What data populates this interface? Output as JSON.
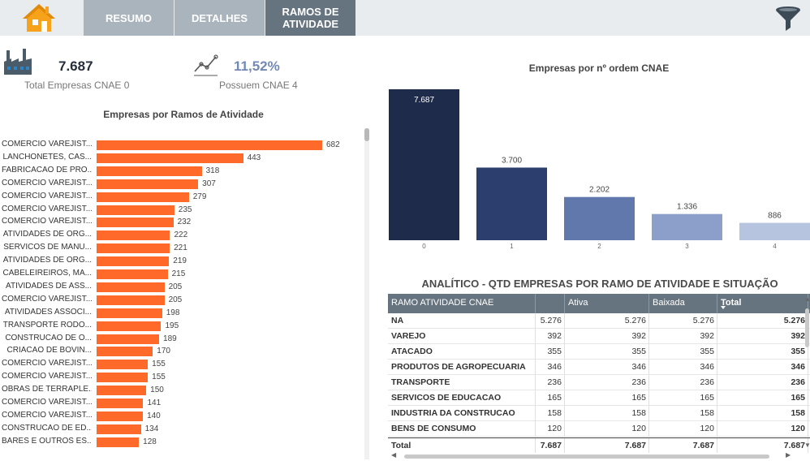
{
  "nav": {
    "tabs": [
      {
        "label": "RESUMO"
      },
      {
        "label": "DETALHES"
      },
      {
        "label": "RAMOS DE\nATIVIDADE"
      }
    ],
    "active_tab": 2
  },
  "kpis": [
    {
      "value": "7.687",
      "label": "Total Empresas CNAE 0"
    },
    {
      "value": "11,52%",
      "label": "Possuem CNAE 4"
    }
  ],
  "colors": {
    "orange": "#ff6a2b",
    "nav_active": "#66747f",
    "nav_inactive": "#a9b4bd",
    "home": "#f7a21b"
  },
  "icons": {
    "home": "home-icon",
    "filter": "filter-icon",
    "factory": "factory-icon",
    "trend": "trend-line-icon"
  },
  "chart_data": [
    {
      "type": "bar",
      "orientation": "horizontal",
      "title": "Empresas por Ramos de Atividade",
      "categories": [
        "COMERCIO VAREJIST...",
        "LANCHONETES, CAS...",
        "FABRICACAO DE PRO...",
        "COMERCIO VAREJIST...",
        "COMERCIO VAREJIST...",
        "COMERCIO VAREJIST...",
        "COMERCIO VAREJIST...",
        "ATIVIDADES DE ORG...",
        "SERVICOS DE MANU...",
        "ATIVIDADES DE ORG...",
        "CABELEIREIROS, MA...",
        "ATIVIDADES DE ASS...",
        "COMERCIO VAREJIST...",
        "ATIVIDADES ASSOCI...",
        "TRANSPORTE RODO...",
        "CONSTRUCAO DE O...",
        "CRIACAO DE BOVIN...",
        "COMERCIO VAREJIST...",
        "COMERCIO VAREJIST...",
        "OBRAS DE TERRAPLE...",
        "COMERCIO VAREJIST...",
        "COMERCIO VAREJIST...",
        "CONSTRUCAO DE ED...",
        "BARES E OUTROS ES..."
      ],
      "values": [
        682,
        443,
        318,
        307,
        279,
        235,
        232,
        222,
        221,
        219,
        215,
        205,
        205,
        198,
        195,
        189,
        170,
        155,
        155,
        150,
        141,
        140,
        134,
        128
      ],
      "value_labels": [
        "682",
        "443",
        "318",
        "307",
        "279",
        "235",
        "232",
        "222",
        "221",
        "219",
        "215",
        "205",
        "205",
        "198",
        "195",
        "189",
        "170",
        "155",
        "155",
        "150",
        "141",
        "140",
        "134",
        "128"
      ],
      "color": "#ff6a2b"
    },
    {
      "type": "bar",
      "title": "Empresas por nº ordem CNAE",
      "categories": [
        "0",
        "1",
        "2",
        "3",
        "4"
      ],
      "values": [
        7687,
        3700,
        2202,
        1336,
        886
      ],
      "value_labels": [
        "7.687",
        "3.700",
        "2.202",
        "1.336",
        "886"
      ],
      "colors": [
        "#1f2b4b",
        "#2c3e6e",
        "#6178ad",
        "#8b9fca",
        "#b7c4e0"
      ]
    }
  ],
  "table": {
    "title": "ANALÍTICO - QTD EMPRESAS POR RAMO DE ATIVIDADE E SITUAÇÃO",
    "headers": [
      "RAMO ATIVIDADE CNAE",
      "",
      "Ativa",
      "Baixada",
      "Total"
    ],
    "rows": [
      [
        "NA",
        "5.276",
        "5.276",
        "5.276",
        "5.276"
      ],
      [
        "VAREJO",
        "392",
        "392",
        "392",
        "392"
      ],
      [
        "ATACADO",
        "355",
        "355",
        "355",
        "355"
      ],
      [
        "PRODUTOS DE AGROPECUARIA",
        "346",
        "346",
        "346",
        "346"
      ],
      [
        "TRANSPORTE",
        "236",
        "236",
        "236",
        "236"
      ],
      [
        "SERVICOS DE EDUCACAO",
        "165",
        "165",
        "165",
        "165"
      ],
      [
        "INDUSTRIA DA CONSTRUCAO",
        "158",
        "158",
        "158",
        "158"
      ],
      [
        "BENS DE CONSUMO",
        "120",
        "120",
        "120",
        "120"
      ]
    ],
    "total_row": [
      "Total",
      "7.687",
      "7.687",
      "7.687",
      "7.687"
    ]
  }
}
